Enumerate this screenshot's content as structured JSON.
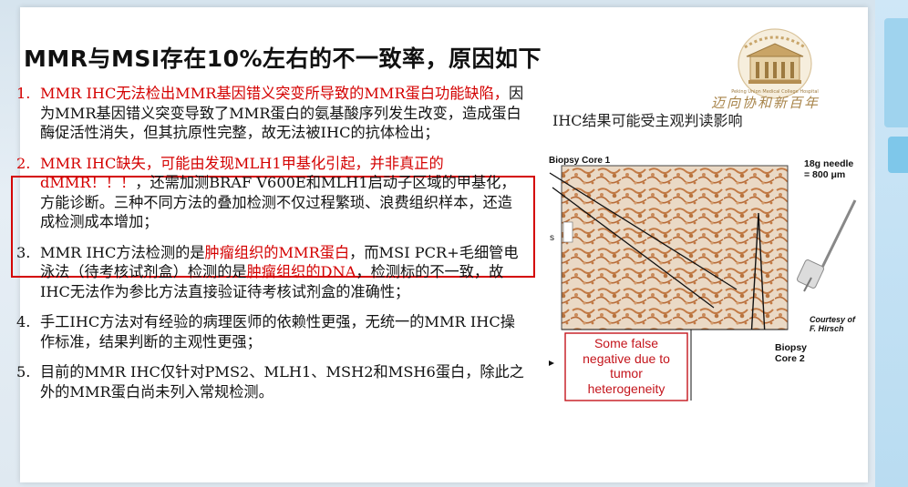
{
  "title": "MMR与MSI存在10%左右的不一致率，原因如下",
  "logo": {
    "slogan": "迈向协和新百年",
    "name": "Peking Union Medical College Hospital"
  },
  "items": [
    {
      "num": "1.",
      "red": "MMR IHC无法检出MMR基因错义突变所导致的MMR蛋白功能缺陷，",
      "rest": "因为MMR基因错义突变导致了MMR蛋白的氨基酸序列发生改变，造成蛋白酶促活性消失，但其抗原性完整，故无法被IHC的抗体检出；"
    },
    {
      "num": "2.",
      "red": "MMR IHC缺失，可能由发现MLH1甲基化引起，并非真正的dMMR！！！",
      "rest": "，还需加测BRAF V600E和MLH1启动子区域的甲基化，方能诊断。三种不同方法的叠加检测不仅过程繁琐、浪费组织样本，还造成检测成本增加；"
    },
    {
      "num": "3.",
      "p1": "MMR IHC方法检测的是",
      "r1": "肿瘤组织的MMR蛋白",
      "p2": "，而MSI PCR+毛细管电泳法（待考核试剂盒）检测的是",
      "r2": "肿瘤组织的DNA",
      "p3": "，检测标的不一致，故IHC无法作为参比方法直接验证待考核试剂盒的准确性；"
    },
    {
      "num": "4.",
      "text": "手工IHC方法对有经验的病理医师的依赖性更强，无统一的MMR IHC操作标准，结果判断的主观性更强；"
    },
    {
      "num": "5.",
      "text": "目前的MMR IHC仅针对PMS2、MLH1、MSH2和MSH6蛋白，除此之外的MMR蛋白尚未列入常规检测。"
    }
  ],
  "figure": {
    "caption": "IHC结果可能受主观判读影响",
    "biopsy_core_1": "Biopsy Core 1",
    "needle_line1": "18g needle",
    "needle_line2": "= 800 μm",
    "courtesy_line1": "Courtesy of",
    "courtesy_line2": "F. Hirsch",
    "false_neg_line1": "Some false",
    "false_neg_line2": "negative due to",
    "false_neg_line3": "tumor",
    "false_neg_line4": "heterogeneity",
    "biopsy_core_2_line1": "Biopsy",
    "biopsy_core_2_line2": "Core 2",
    "side_mark": "s",
    "colors": {
      "stain": "#c98a5a",
      "tissue_bg": "#e8d8c6",
      "red_text": "#c4151c"
    }
  },
  "colors": {
    "accent_red": "#d40000",
    "logo_gold": "#a8844a"
  }
}
